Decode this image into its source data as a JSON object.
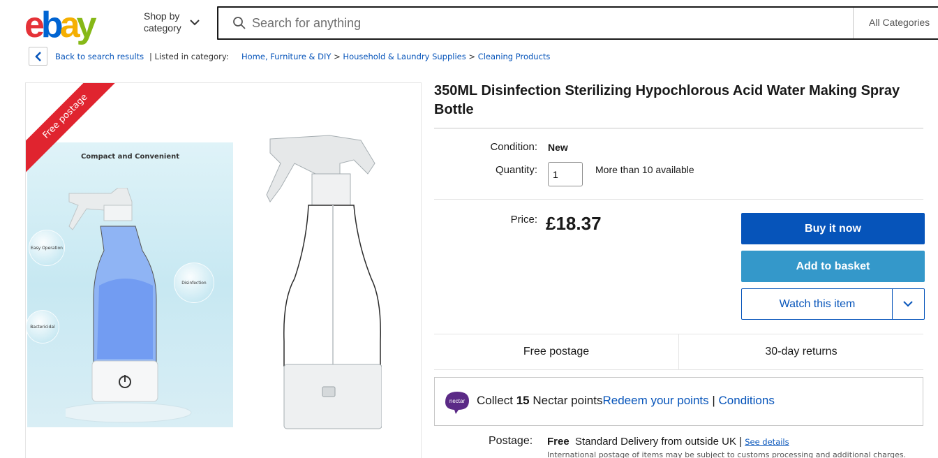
{
  "header": {
    "logo_letters": [
      "e",
      "b",
      "a",
      "y"
    ],
    "logo_colors": [
      "#e53238",
      "#0064d2",
      "#f5af02",
      "#86b817"
    ],
    "shop_by_line1": "Shop by",
    "shop_by_line2": "category",
    "search_placeholder": "Search for anything",
    "category_select": "All Categories"
  },
  "breadcrumb": {
    "back_label": "Back to search results",
    "listed_in": "| Listed in category:",
    "items": [
      "Home, Furniture & DIY",
      "Household & Laundry Supplies",
      "Cleaning Products"
    ],
    "separator": ">"
  },
  "gallery": {
    "ribbon": "Free postage",
    "promo_title": "Compact and Convenient",
    "bubbles": [
      "Easy Operation",
      "Disinfection",
      "Bactericidal"
    ]
  },
  "product": {
    "title": "350ML Disinfection Sterilizing Hypochlorous Acid Water Making Spray Bottle",
    "condition_label": "Condition:",
    "condition_value": "New",
    "quantity_label": "Quantity:",
    "quantity_value": "1",
    "availability": "More than 10 available",
    "price_label": "Price:",
    "price": "£18.37",
    "buy_now": "Buy it now",
    "add_to_basket": "Add to basket",
    "watch": "Watch this item"
  },
  "shipping": {
    "free_postage": "Free postage",
    "returns": "30-day returns"
  },
  "nectar": {
    "logo_text": "nectar",
    "collect_pre": "Collect ",
    "points": "15",
    "collect_post": " Nectar points",
    "redeem_link": "Redeem your points",
    "sep": " | ",
    "conditions_link": "Conditions"
  },
  "postage": {
    "label": "Postage:",
    "free": "Free",
    "method": "Standard Delivery from outside UK |",
    "see_details": "See details",
    "note": "International postage of items may be subject to customs processing and additional charges."
  }
}
